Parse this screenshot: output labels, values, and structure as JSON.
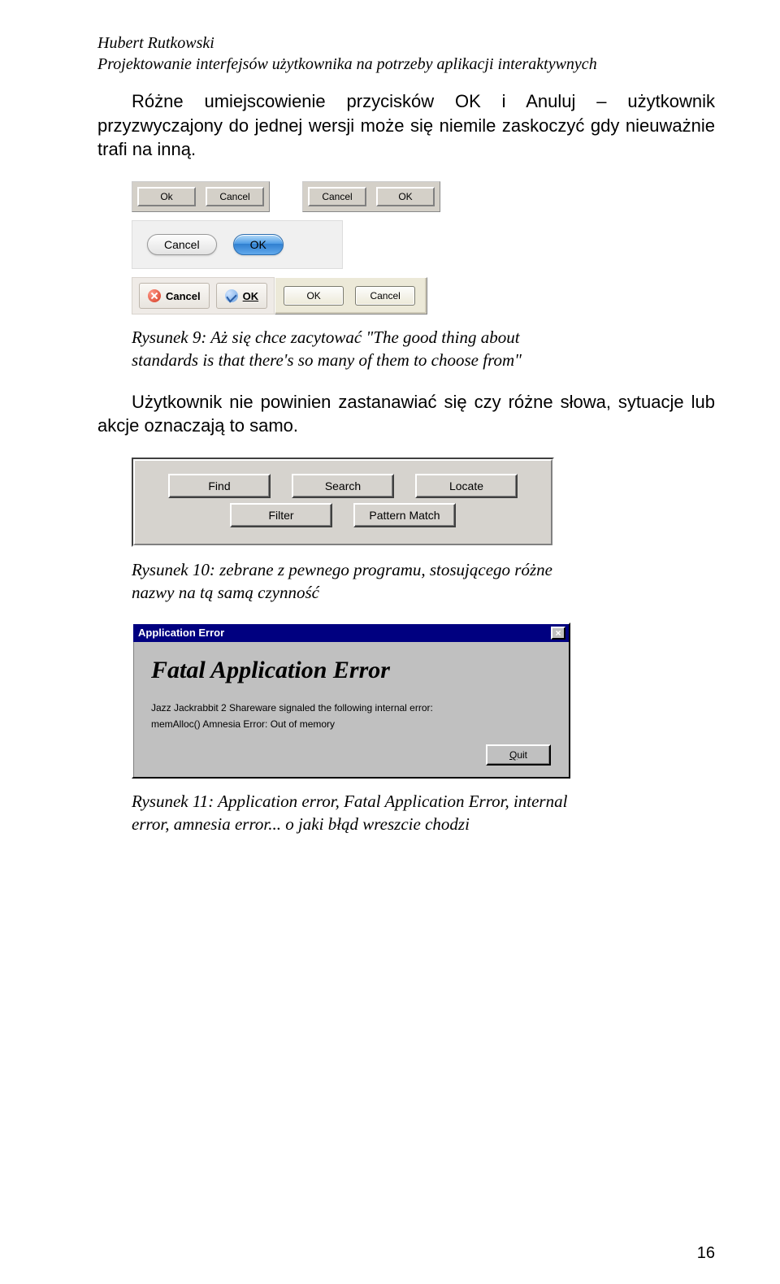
{
  "header": {
    "author": "Hubert Rutkowski",
    "title": "Projektowanie interfejsów użytkownika na potrzeby aplikacji interaktywnych"
  },
  "para1": "Różne umiejscowienie przycisków OK i Anuluj – użytkownik przyzwyczajony do jednej wersji może się niemile zaskoczyć gdy nieuważnie trafi na inną.",
  "fig1": {
    "groupA": {
      "btn1": "Ok",
      "btn2": "Cancel"
    },
    "groupB": {
      "btn1": "Cancel",
      "btn2": "OK"
    }
  },
  "fig2": {
    "btn1": "Cancel",
    "btn2": "OK"
  },
  "fig3": {
    "gnome": {
      "btn1": "Cancel",
      "btn2": "OK"
    },
    "xp": {
      "btn1": "OK",
      "btn2": "Cancel"
    }
  },
  "caption9": "Rysunek 9: Aż się chce zacytować \"The good thing about standards is that there's so many of them to choose from\"",
  "para2": "Użytkownik nie powinien zastanawiać się czy różne słowa, sytuacje lub akcje oznaczają to samo.",
  "fig4": {
    "row1": [
      "Find",
      "Search",
      "Locate"
    ],
    "row2": [
      "Filter",
      "Pattern Match"
    ]
  },
  "caption10": "Rysunek 10: zebrane z pewnego programu, stosującego różne nazwy na tą samą czynność",
  "fig5": {
    "title": "Application Error",
    "close": "×",
    "heading": "Fatal Application Error",
    "line1": "Jazz Jackrabbit 2 Shareware signaled the following internal error:",
    "line2": "memAlloc() Amnesia Error: Out of memory",
    "quit": "Quit"
  },
  "caption11": "Rysunek 11: Application error, Fatal Application Error, internal error, amnesia error... o jaki błąd wreszcie chodzi",
  "pagenum": "16"
}
